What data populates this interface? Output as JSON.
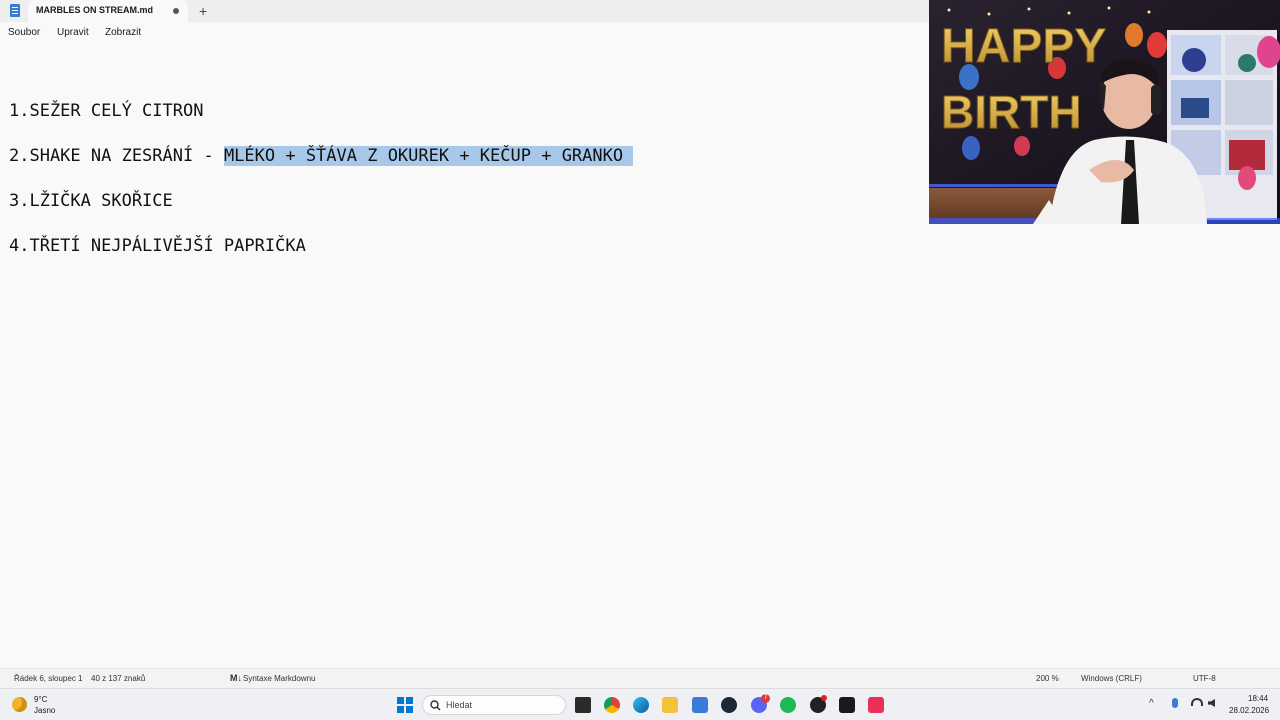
{
  "tab": {
    "title": "MARBLES ON STREAM.md",
    "new_tab": "+"
  },
  "menu": {
    "file": "Soubor",
    "edit": "Upravit",
    "view": "Zobrazit"
  },
  "document": {
    "line1": "1.SEŽER CELÝ CITRON",
    "line2_prefix": "2.SHAKE NA ZESRÁNÍ - ",
    "line2_selected": "MLÉKO + ŠŤÁVA Z OKUREK + KEČUP + GRANKO",
    "line3": "3.LŽIČKA SKOŘICE",
    "line4": "4.TŘETÍ NEJPÁLIVĚJŠÍ PAPRIČKA"
  },
  "webcam": {
    "balloon_letters_top": "HAPPY",
    "balloon_letters_bottom": "BIRTH"
  },
  "status": {
    "position": "Řádek 6, sloupec 1",
    "chars": "40 z 137 znaků",
    "syntax": "Syntaxe Markdownu",
    "zoom": "200 %",
    "line_endings": "Windows (CRLF)",
    "encoding": "UTF-8"
  },
  "taskbar": {
    "weather_temp": "9°C",
    "weather_desc": "Jasno",
    "search_placeholder": "Hledat",
    "time": "18:44",
    "date": "28.02.2026",
    "discord_badge": "7"
  },
  "colors": {
    "selection": "#a8c8ea",
    "accent": "#0067c0"
  }
}
